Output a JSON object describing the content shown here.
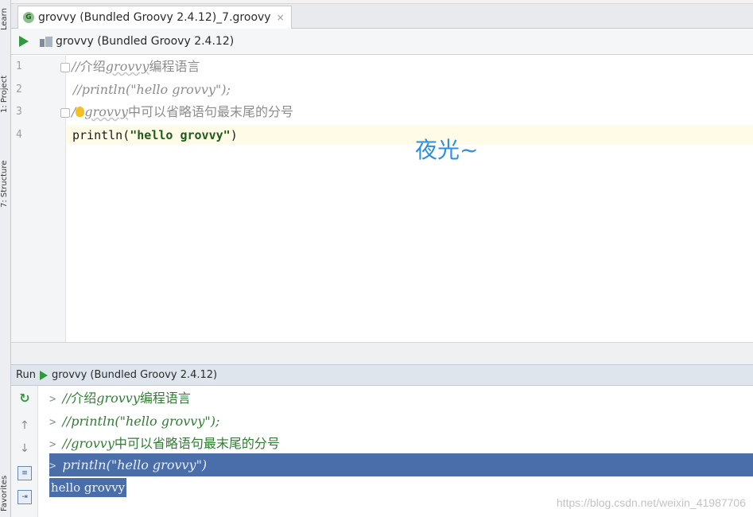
{
  "sidebar_tabs": {
    "learn": "Learn",
    "project": "1: Project",
    "structure": "7: Structure",
    "favorites": "Favorites"
  },
  "tab": {
    "icon_letter": "G",
    "title": "grovvy (Bundled Groovy 2.4.12)_7.groovy",
    "close": "×"
  },
  "breadcrumb": {
    "label": "grovvy (Bundled Groovy 2.4.12)"
  },
  "editor": {
    "lines": [
      {
        "no": "1",
        "prefix": "//",
        "cn": "介绍",
        "latin": "grovvy",
        "cn2": "编程语言"
      },
      {
        "no": "2",
        "text": "//println(\"hello grovvy\");"
      },
      {
        "no": "3",
        "prefix": "/",
        "latin": "grovvy",
        "cn": "中可以省略语句最末尾的分号"
      },
      {
        "no": "4",
        "code_pre": "println(",
        "string": "\"hello grovvy\"",
        "code_post": ")"
      }
    ],
    "overlay_text": "夜光~"
  },
  "run": {
    "label": "Run",
    "config": "grovvy (Bundled Groovy 2.4.12)",
    "console": [
      {
        "chev": ">",
        "prefix": "//",
        "cn": "介绍",
        "latin": "grovvy",
        "cn2": "编程语言"
      },
      {
        "chev": ">",
        "text": "//println(\"hello grovvy\");"
      },
      {
        "chev": ">",
        "prefix": "//",
        "latin": "grovvy",
        "cn": "中可以省略语句最末尾的分号"
      },
      {
        "chev": ">",
        "text": "println(\"hello grovvy\")"
      }
    ],
    "output": "hello grovvy"
  },
  "watermark": "https://blog.csdn.net/weixin_41987706",
  "colors": {
    "run_green": "#2f9a3b",
    "selection": "#4a6ea9",
    "overlay_blue": "#2b8fe3",
    "current_line": "#fffbe6"
  },
  "icons": [
    "run-icon",
    "groovy-file-icon",
    "rerun-icon",
    "arrow-up-icon",
    "arrow-down-icon",
    "soft-wrap-icon",
    "export-icon"
  ]
}
